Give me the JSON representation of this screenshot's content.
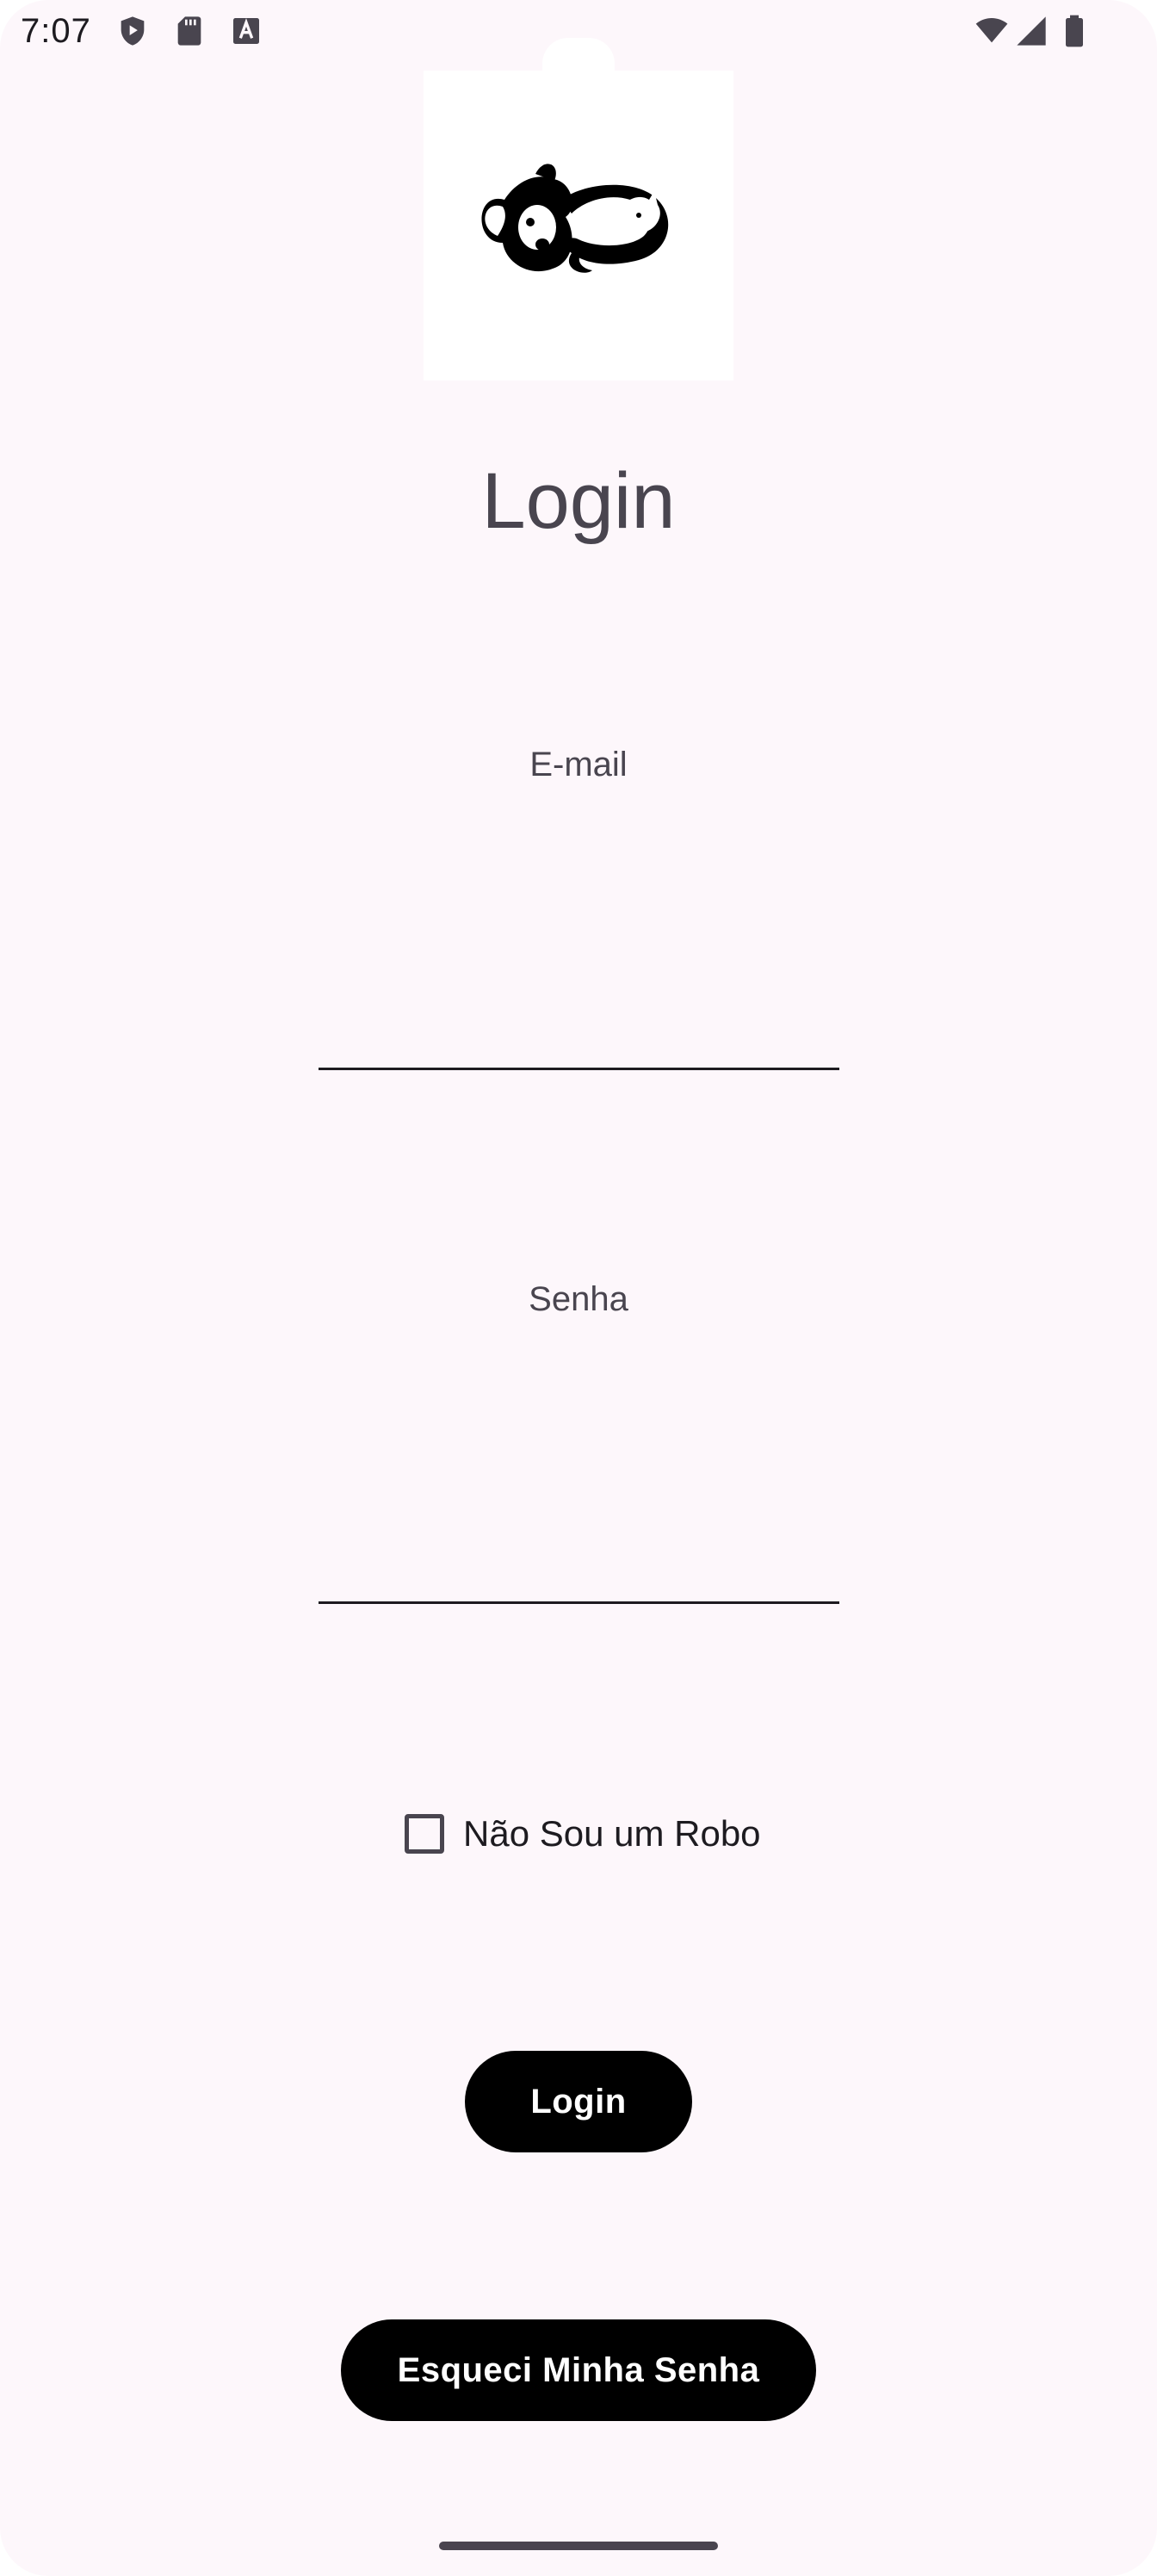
{
  "status_bar": {
    "time": "7:07",
    "left_icons": [
      "shield-play-icon",
      "sd-card-icon",
      "text-a-icon"
    ],
    "right_icons": [
      "wifi-icon",
      "signal-icon",
      "battery-icon"
    ]
  },
  "logo": {
    "icon": "dog-cat-logo-icon"
  },
  "page": {
    "title": "Login"
  },
  "form": {
    "email_label": "E-mail",
    "email_value": "",
    "password_label": "Senha",
    "password_value": "",
    "robot_checkbox_label": "Não Sou um Robo",
    "robot_checked": false
  },
  "actions": {
    "login_label": "Login",
    "forgot_password_label": "Esqueci Minha Senha"
  },
  "colors": {
    "background": "#fdf7fb",
    "button": "#000000",
    "button_text": "#ffffff",
    "text_muted": "#49454f"
  }
}
